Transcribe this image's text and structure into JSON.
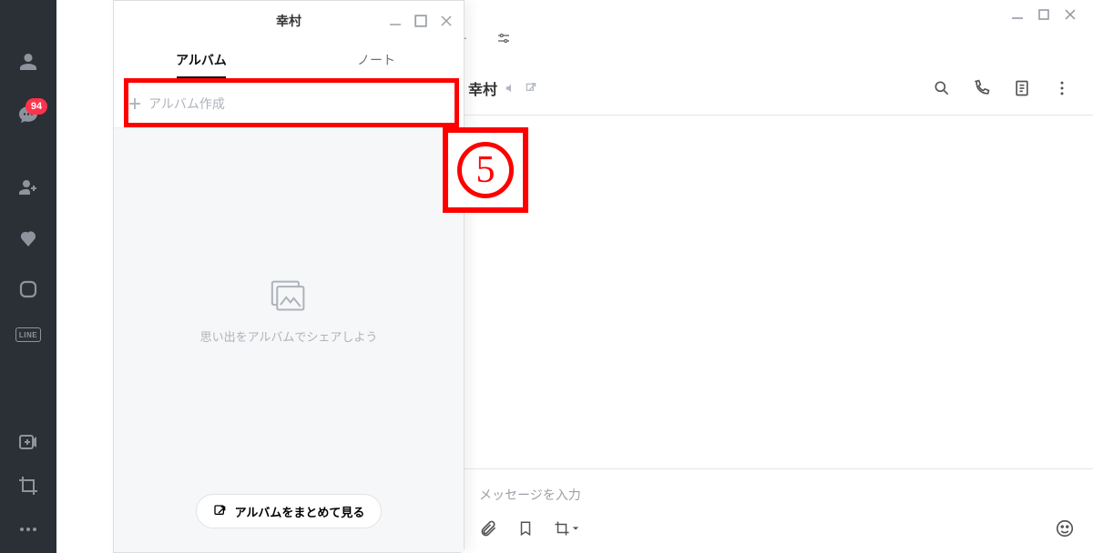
{
  "sidebar": {
    "chat_badge": "94",
    "line_label": "LINE"
  },
  "topbar": {
    "chat_text": "ャット"
  },
  "chat": {
    "title": "幸村",
    "input_placeholder": "メッセージを入力"
  },
  "popup": {
    "title": "幸村",
    "tabs": {
      "album": "アルバム",
      "note": "ノート"
    },
    "create_label": "アルバム作成",
    "empty_text": "思い出をアルバムでシェアしよう",
    "view_all_label": "アルバムをまとめて見る"
  },
  "annotation": {
    "step": "5"
  }
}
